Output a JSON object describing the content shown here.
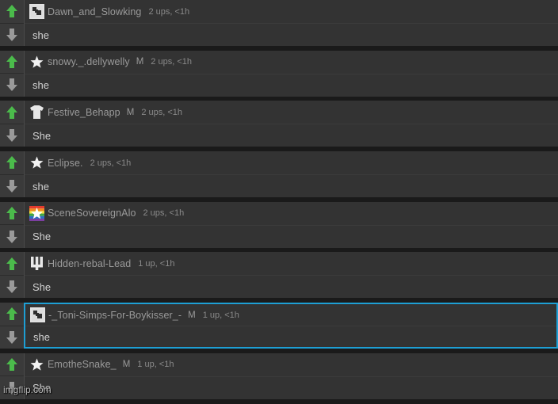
{
  "theme": {
    "page_background": "#1a1a1a",
    "card_background": "#333333",
    "vote_background": "#3a3a3a",
    "upvote_color": "#4bbb4b",
    "downvote_color": "#9a9a9a",
    "username_color": "#9a9a9a",
    "body_text_color": "#d2d2d2",
    "selection_border_color": "#1e9fd4"
  },
  "icons": {
    "upvote": "arrow-up-icon",
    "downvote": "arrow-down-icon"
  },
  "watermark": {
    "text": "imgflip.com"
  },
  "comments": [
    {
      "username": "Dawn_and_Slowking",
      "mod_badge": "",
      "score": "2 ups, <1h",
      "body": "she",
      "avatar": "pixel-snoo-avatar",
      "selected": false
    },
    {
      "username": "snowy._.dellywelly",
      "mod_badge": "M",
      "score": "2 ups, <1h",
      "body": "she",
      "avatar": "star-avatar",
      "selected": false
    },
    {
      "username": "Festive_Behapp",
      "mod_badge": "M",
      "score": "2 ups, <1h",
      "body": "She",
      "avatar": "tshirt-avatar",
      "selected": false
    },
    {
      "username": "Eclipse.",
      "mod_badge": "",
      "score": "2 ups, <1h",
      "body": "she",
      "avatar": "star-avatar",
      "selected": false
    },
    {
      "username": "SceneSovereignAlo",
      "mod_badge": "",
      "score": "2 ups, <1h",
      "body": "She",
      "avatar": "rainbow-star-avatar",
      "selected": false
    },
    {
      "username": "Hidden-rebal-Lead",
      "mod_badge": "",
      "score": "1 up, <1h",
      "body": "She",
      "avatar": "trident-avatar",
      "selected": false
    },
    {
      "username": "-_Toni-Simps-For-Boykisser_-",
      "mod_badge": "M",
      "score": "1 up, <1h",
      "body": "she",
      "avatar": "pixel-snoo-avatar",
      "selected": true
    },
    {
      "username": "EmotheSnake_",
      "mod_badge": "M",
      "score": "1 up, <1h",
      "body": "She",
      "avatar": "star-avatar",
      "selected": false
    }
  ]
}
